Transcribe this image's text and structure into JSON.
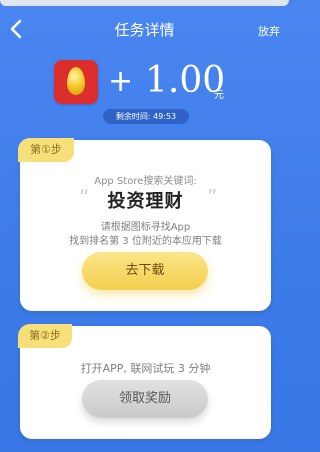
{
  "nav": {
    "back_icon": "chevron-left-icon",
    "title": "任务详情",
    "give_up": "放弃"
  },
  "reward": {
    "app_icon": "golden-egg-icon",
    "plus": "+",
    "amount": "1.00",
    "unit": "元",
    "timer": "剩余时间: 49:53"
  },
  "step1": {
    "tag": "第①步",
    "search_label": "App Store搜索关键词:",
    "keyword": "投资理财",
    "open_quote": "“",
    "close_quote": "”",
    "instruction_1": "请根据图标寻找App",
    "instruction_2": "找到排名第 3 位附近的本应用下载",
    "button": "去下载"
  },
  "step2": {
    "tag": "第②步",
    "task": "打开APP, 联网试玩 3 分钟",
    "button": "领取奖励"
  },
  "colors": {
    "background": "#4a86f0",
    "tag": "#f7df7a",
    "download_button": "#f4ce4d",
    "claim_button": "#cacaca",
    "app_icon_bg": "#dd2e2e"
  }
}
